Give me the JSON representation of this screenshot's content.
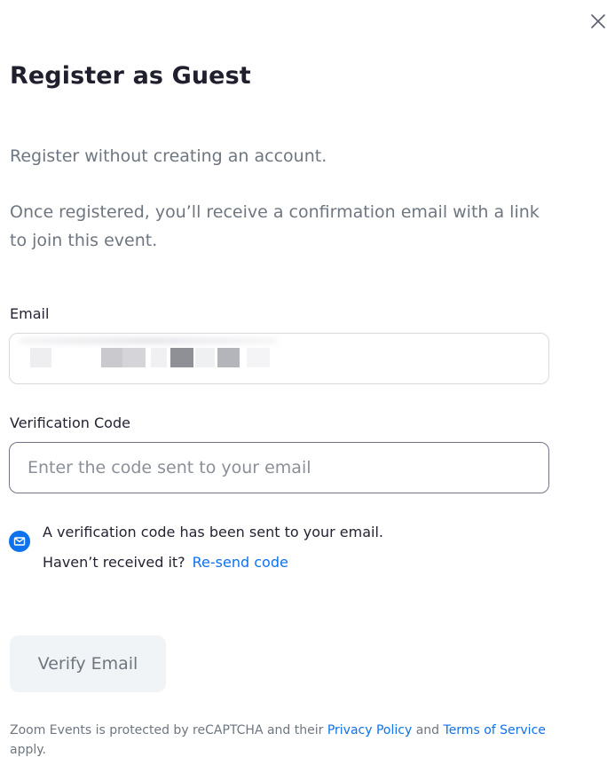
{
  "dialog": {
    "title": "Register as Guest",
    "close_label": "×"
  },
  "intro": {
    "line1": "Register without creating an account.",
    "line2": "Once registered, you’ll receive a confirmation email with a link to join this event."
  },
  "form": {
    "email": {
      "label": "Email",
      "value": ""
    },
    "verification_code": {
      "label": "Verification Code",
      "value": "",
      "placeholder": "Enter the code sent to your email"
    }
  },
  "notice": {
    "message": "A verification code has been sent to your email.",
    "question": "Haven’t received it?",
    "resend_label": "Re-send code",
    "icon": "mail-icon"
  },
  "actions": {
    "verify_label": "Verify Email"
  },
  "footer": {
    "prefix": "Zoom Events is protected by reCAPTCHA and their",
    "privacy_label": "Privacy Policy",
    "and": "and",
    "terms_label": "Terms of Service",
    "suffix": "apply."
  },
  "colors": {
    "brand_blue": "#0e72ed",
    "text_dark": "#232333",
    "text_muted": "#6e7680",
    "button_disabled_bg": "#f1f4f6"
  }
}
